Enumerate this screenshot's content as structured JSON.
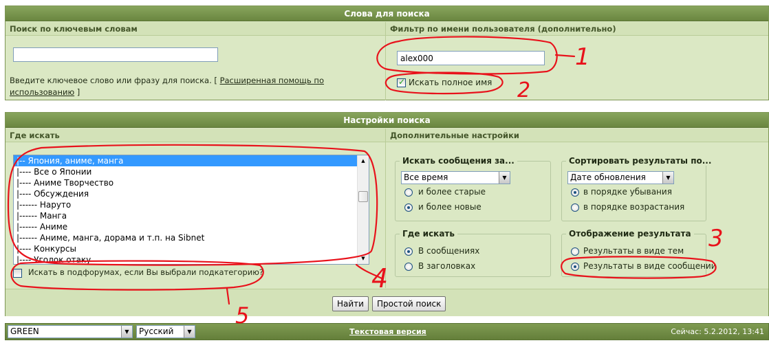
{
  "keywords_panel": {
    "title": "Слова для поиска",
    "left_header": "Поиск по ключевым словам",
    "right_header": "Фильтр по имени пользователя (дополнительно)",
    "keyword_value": "",
    "hint_text": "Введите ключевое слово или фразу для поиска. [ ",
    "help_link": "Расширенная помощь по использованию",
    "hint_close": " ]",
    "username_value": "alex000",
    "exact_name_label": "Искать полное имя",
    "exact_name_checked": true
  },
  "settings_panel": {
    "title": "Настройки поиска",
    "where_header": "Где искать",
    "extra_header": "Дополнительные настройки",
    "forum_items": [
      "|-- Япония, аниме, манга",
      "|---- Все о Японии",
      "|---- Аниме Творчество",
      "|---- Обсуждения",
      "|------ Наруто",
      "|------ Манга",
      "|------ Аниме",
      "|------ Аниме, манга, дорама и т.п. на Sibnet",
      "|---- Конкурсы",
      "|---- Уголок отаку"
    ],
    "subforums_label": "Искать в подфорумах, если Вы выбрали подкатегорию?",
    "period": {
      "legend": "Искать сообщения за...",
      "selected": "Все время",
      "options": [
        "и более старые",
        "и более новые"
      ],
      "checked_index": 1
    },
    "sort": {
      "legend": "Сортировать результаты по...",
      "selected": "Дате обновления",
      "options": [
        "в порядке убывания",
        "в порядке возрастания"
      ],
      "checked_index": 0
    },
    "where": {
      "legend": "Где искать",
      "options": [
        "В сообщениях",
        "В заголовках"
      ],
      "checked_index": 0
    },
    "display": {
      "legend": "Отображение результата",
      "options": [
        "Результаты в виде тем",
        "Результаты в виде сообщении"
      ],
      "checked_index": 1
    },
    "search_button": "Найти",
    "simple_button": "Простой поиск"
  },
  "footer": {
    "skin": "GREEN",
    "language": "Русский",
    "text_version": "Текстовая версия",
    "now": "Сейчас: 5.2.2012, 13:41"
  },
  "annotations": [
    "1",
    "2",
    "3",
    "4",
    "5"
  ],
  "colors": {
    "header_green": "#6a8640",
    "panel_bg": "#dbe8c4",
    "annotation_red": "#e8121b",
    "selection_blue": "#3399ff"
  }
}
